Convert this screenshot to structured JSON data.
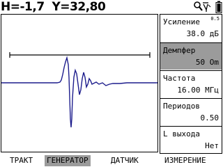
{
  "readout": {
    "h_label": "H=",
    "h_value": "-1,7",
    "y_label": "Y=",
    "y_value": "32,80"
  },
  "top_icons": [
    "magnifier-icon",
    "probe-icon",
    "battery-icon"
  ],
  "scope": {
    "trace_color": "#1c1c8c",
    "gate_color": "#000000"
  },
  "panel": {
    "items": [
      {
        "label": "Усиление",
        "value": "38.0 дБ",
        "superscript": "0.5",
        "selected": false
      },
      {
        "label": "Демпфер",
        "value": "50 Om",
        "selected": true
      },
      {
        "label": "Частота",
        "value": "16.00 МГц",
        "selected": false
      },
      {
        "label": "Периодов",
        "value": "0.50",
        "selected": false
      },
      {
        "label": "L выхода",
        "value": "Нет",
        "selected": false
      }
    ]
  },
  "tabs": [
    {
      "label": "ТРАКТ",
      "active": false
    },
    {
      "label": "ГЕНЕРАТОР",
      "active": true
    },
    {
      "label": "ДАТЧИК",
      "active": false
    },
    {
      "label": "ИЗМЕРЕНИЕ",
      "active": false
    }
  ]
}
